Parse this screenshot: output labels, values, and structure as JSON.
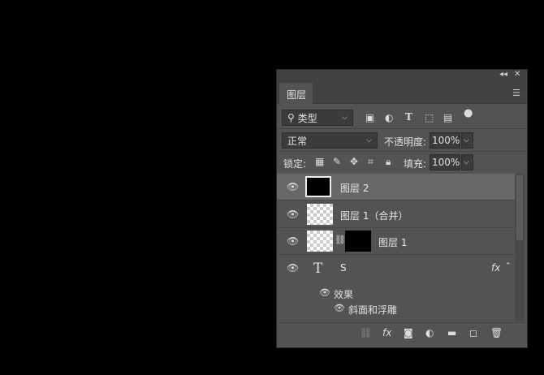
{
  "panel": {
    "collapse_icon": "double-chevron-left",
    "close_icon": "x",
    "tab": "图层",
    "menu_icon": "hamburger"
  },
  "filter": {
    "kind": "类型",
    "icons": [
      "image-filter",
      "adjustment-filter",
      "type-filter",
      "shape-filter",
      "smart-object-filter",
      "filter-toggle"
    ]
  },
  "blend": {
    "mode": "正常",
    "opacity_label": "不透明度:",
    "opacity": "100%"
  },
  "lock": {
    "label": "锁定:",
    "fill_label": "填充:",
    "fill": "100%"
  },
  "layers": [
    {
      "name": "图层 2",
      "selected": true
    },
    {
      "name": "图层 1（合并）"
    },
    {
      "name": "图层 1"
    },
    {
      "name": "S",
      "type": "text",
      "fx": "fx",
      "effects_label": "效果",
      "effects": [
        "斜面和浮雕"
      ]
    }
  ],
  "bottom": {
    "fx": "fx"
  }
}
